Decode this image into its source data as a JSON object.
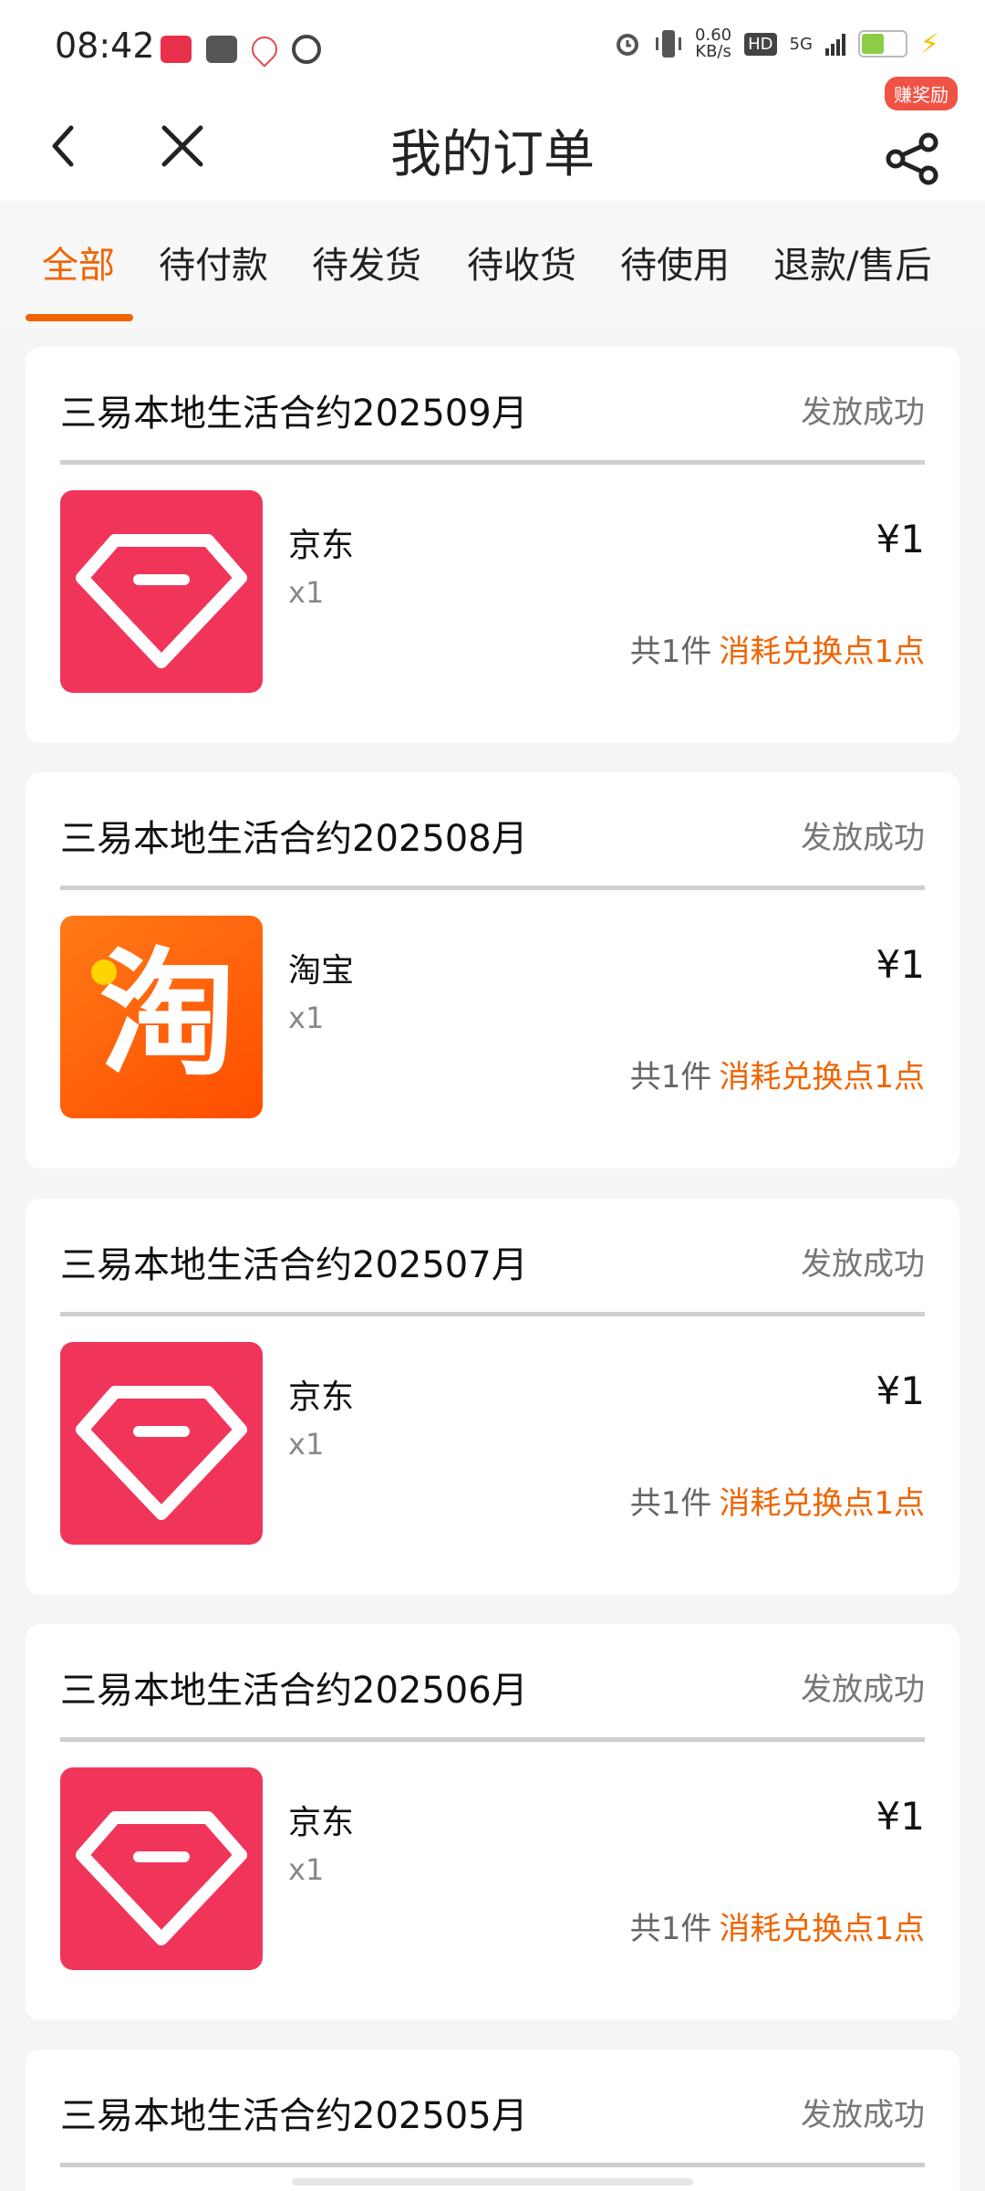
{
  "status_bar": {
    "time": "08:42",
    "net_speed_value": "0.60",
    "net_speed_unit": "KB/s",
    "hd_label": "HD",
    "network_label": "5G"
  },
  "header": {
    "title": "我的订单",
    "reward_badge": "赚奖励"
  },
  "tabs": [
    {
      "label": "全部",
      "active": true
    },
    {
      "label": "待付款"
    },
    {
      "label": "待发货"
    },
    {
      "label": "待收货"
    },
    {
      "label": "待使用"
    },
    {
      "label": "退款/售后"
    }
  ],
  "orders": [
    {
      "title": "三易本地生活合约202509月",
      "status": "发放成功",
      "item_name": "京东",
      "item_icon": "jd-diamond-icon",
      "qty": "x1",
      "price": "¥1",
      "count": "共1件",
      "points": "消耗兑换点1点"
    },
    {
      "title": "三易本地生活合约202508月",
      "status": "发放成功",
      "item_name": "淘宝",
      "item_icon": "taobao-icon",
      "icon_text": "淘",
      "qty": "x1",
      "price": "¥1",
      "count": "共1件",
      "points": "消耗兑换点1点"
    },
    {
      "title": "三易本地生活合约202507月",
      "status": "发放成功",
      "item_name": "京东",
      "item_icon": "jd-diamond-icon",
      "qty": "x1",
      "price": "¥1",
      "count": "共1件",
      "points": "消耗兑换点1点"
    },
    {
      "title": "三易本地生活合约202506月",
      "status": "发放成功",
      "item_name": "京东",
      "item_icon": "jd-diamond-icon",
      "qty": "x1",
      "price": "¥1",
      "count": "共1件",
      "points": "消耗兑换点1点"
    },
    {
      "title": "三易本地生活合约202505月",
      "status": "发放成功"
    }
  ],
  "colors": {
    "accent": "#f06400",
    "jd_red": "#f1355a",
    "taobao_orange": "#ff5a00"
  }
}
